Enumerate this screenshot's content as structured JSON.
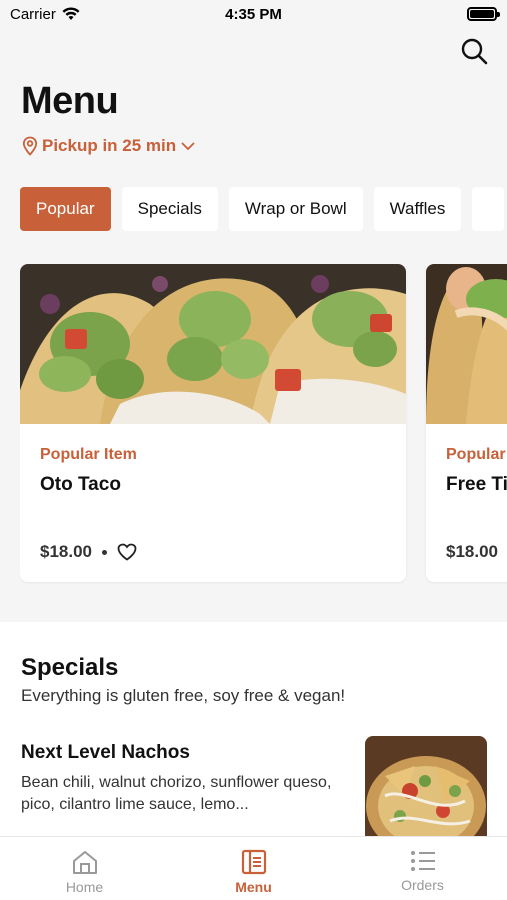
{
  "status_bar": {
    "carrier": "Carrier",
    "time": "4:35 PM"
  },
  "header": {
    "title": "Menu",
    "pickup": "Pickup in 25 min"
  },
  "tabs": [
    {
      "label": "Popular",
      "active": true
    },
    {
      "label": "Specials",
      "active": false
    },
    {
      "label": "Wrap or Bowl",
      "active": false
    },
    {
      "label": "Waffles",
      "active": false
    }
  ],
  "cards": [
    {
      "category": "Popular Item",
      "name": "Oto Taco",
      "price": "$18.00"
    },
    {
      "category": "Popular",
      "name": "Free Ti",
      "price": "$18.00"
    }
  ],
  "specials": {
    "title": "Specials",
    "subtitle": "Everything is gluten free, soy free & vegan!",
    "item": {
      "name": "Next Level Nachos",
      "description": "Bean chili, walnut chorizo, sunflower queso, pico, cilantro lime sauce, lemo..."
    }
  },
  "tabbar": [
    {
      "label": "Home",
      "icon": "home-icon"
    },
    {
      "label": "Menu",
      "icon": "menu-book-icon",
      "active": true
    },
    {
      "label": "Orders",
      "icon": "list-icon"
    }
  ],
  "colors": {
    "accent": "#c8613a",
    "background": "#f5f5f5"
  }
}
